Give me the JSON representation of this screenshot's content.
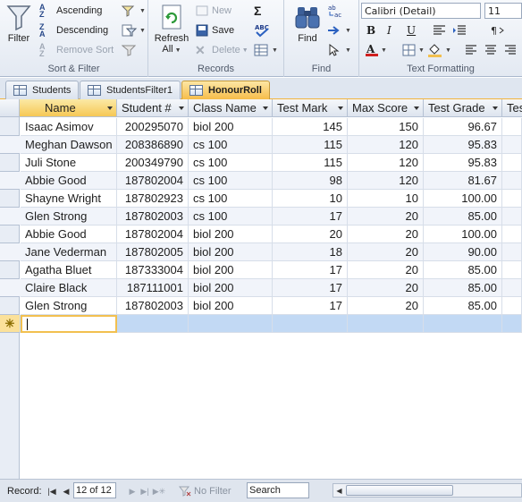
{
  "ribbon": {
    "sort_filter": {
      "label": "Sort & Filter",
      "filter": "Filter",
      "ascending": "Ascending",
      "descending": "Descending",
      "remove_sort": "Remove Sort"
    },
    "records": {
      "label": "Records",
      "refresh": "Refresh",
      "refresh_sub": "All",
      "new": "New",
      "save": "Save",
      "delete": "Delete"
    },
    "find": {
      "label": "Find",
      "find": "Find"
    },
    "text_formatting": {
      "label": "Text Formatting",
      "font_name": "Calibri (Detail)",
      "font_size": "11",
      "bold": "B",
      "italic": "I",
      "underline": "U"
    }
  },
  "tabs": [
    {
      "label": "Students",
      "active": false
    },
    {
      "label": "StudentsFilter1",
      "active": false
    },
    {
      "label": "HonourRoll",
      "active": true
    }
  ],
  "table": {
    "columns": [
      "Name",
      "Student #",
      "Class Name",
      "Test Mark",
      "Max Score",
      "Test Grade",
      "Tes"
    ],
    "rows": [
      [
        "Isaac Asimov",
        "200295070",
        "biol 200",
        "145",
        "150",
        "96.67"
      ],
      [
        "Meghan Dawson",
        "208386890",
        "cs 100",
        "115",
        "120",
        "95.83"
      ],
      [
        "Juli Stone",
        "200349790",
        "cs 100",
        "115",
        "120",
        "95.83"
      ],
      [
        "Abbie Good",
        "187802004",
        "cs 100",
        "98",
        "120",
        "81.67"
      ],
      [
        "Shayne Wright",
        "187802923",
        "cs 100",
        "10",
        "10",
        "100.00"
      ],
      [
        "Glen Strong",
        "187802003",
        "cs 100",
        "17",
        "20",
        "85.00"
      ],
      [
        "Abbie Good",
        "187802004",
        "biol 200",
        "20",
        "20",
        "100.00"
      ],
      [
        "Jane Vederman",
        "187802005",
        "biol 200",
        "18",
        "20",
        "90.00"
      ],
      [
        "Agatha Bluet",
        "187333004",
        "biol 200",
        "17",
        "20",
        "85.00"
      ],
      [
        "Claire Black",
        "187111001",
        "biol 200",
        "17",
        "20",
        "85.00"
      ],
      [
        "Glen Strong",
        "187802003",
        "biol 200",
        "17",
        "20",
        "85.00"
      ]
    ],
    "new_row_marker": "✳"
  },
  "navbar": {
    "record_label": "Record:",
    "record_value": "12 of 12",
    "no_filter": "No Filter",
    "search_label": "Search"
  },
  "colors": {
    "active_tab": "#f6bd4a",
    "new_row": "#c2d9f4",
    "selected_header": "#f6c855"
  }
}
